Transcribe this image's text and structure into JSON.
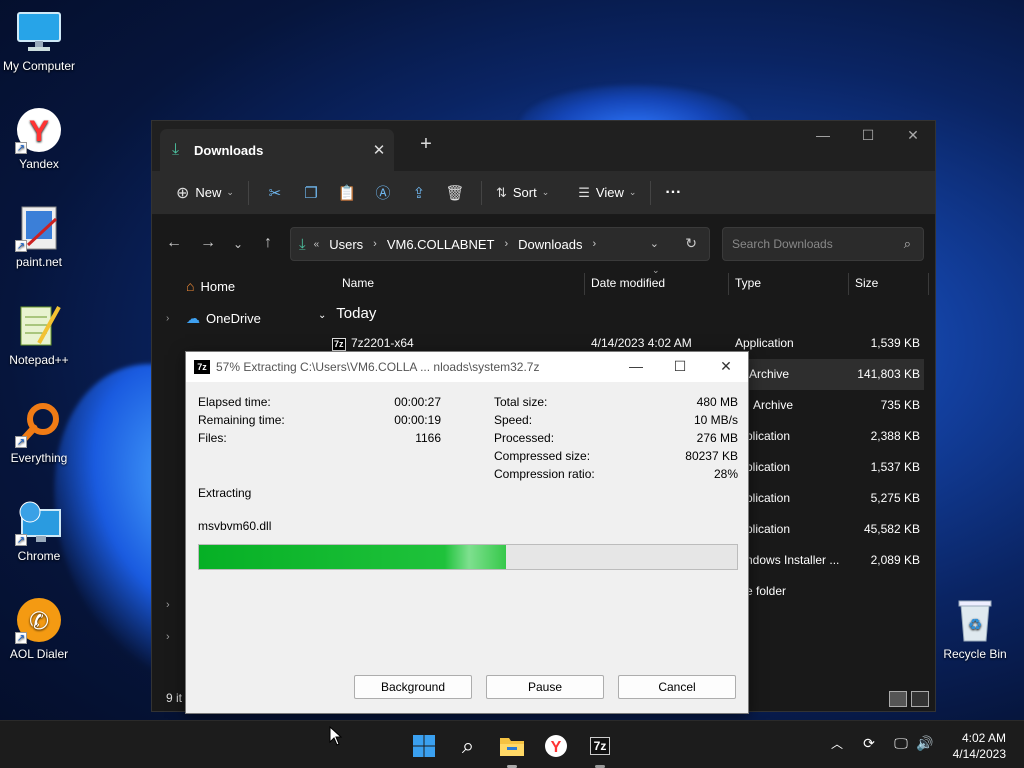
{
  "desktop": {
    "icons": [
      {
        "label": "My Computer",
        "icon": "monitor-icon"
      },
      {
        "label": "Yandex",
        "icon": "yandex-icon"
      },
      {
        "label": "paint.net",
        "icon": "paintnet-icon"
      },
      {
        "label": "Notepad++",
        "icon": "notepadpp-icon"
      },
      {
        "label": "Everything",
        "icon": "everything-icon"
      },
      {
        "label": "Chrome",
        "icon": "chrome-icon"
      },
      {
        "label": "AOL Dialer",
        "icon": "aol-dialer-icon"
      },
      {
        "label": "Recycle Bin",
        "icon": "recycle-bin-icon"
      }
    ]
  },
  "explorer": {
    "tab_title": "Downloads",
    "toolbar": {
      "new_label": "New",
      "sort_label": "Sort",
      "view_label": "View",
      "more_label": "···"
    },
    "breadcrumb": [
      "Users",
      "VM6.COLLABNET",
      "Downloads"
    ],
    "search_placeholder": "Search Downloads",
    "nav": {
      "home": "Home",
      "onedrive": "OneDrive"
    },
    "columns": {
      "name": "Name",
      "date": "Date modified",
      "type": "Type",
      "size": "Size"
    },
    "group": "Today",
    "rows": [
      {
        "name": "7z2201-x64",
        "date": "4/14/2023 4:02 AM",
        "type": "Application",
        "size": "1,539 KB"
      },
      {
        "name": "",
        "date": "",
        "type": "Archive",
        "size": "141,803 KB"
      },
      {
        "name": "",
        "date": "",
        "type": "Archive",
        "size": "735 KB"
      },
      {
        "name": "",
        "date": "",
        "type": "plication",
        "size": "2,388 KB"
      },
      {
        "name": "",
        "date": "",
        "type": "plication",
        "size": "1,537 KB"
      },
      {
        "name": "",
        "date": "",
        "type": "plication",
        "size": "5,275 KB"
      },
      {
        "name": "",
        "date": "",
        "type": "plication",
        "size": "45,582 KB"
      },
      {
        "name": "",
        "date": "",
        "type": "ndows Installer ...",
        "size": "2,089 KB"
      },
      {
        "name": "",
        "date": "",
        "type": "e folder",
        "size": ""
      }
    ],
    "status": "9 it"
  },
  "sevenzip": {
    "title": "57% Extracting C:\\Users\\VM6.COLLA ... nloads\\system32.7z",
    "elapsed_label": "Elapsed time:",
    "elapsed": "00:00:27",
    "remaining_label": "Remaining time:",
    "remaining": "00:00:19",
    "files_label": "Files:",
    "files": "1166",
    "total_label": "Total size:",
    "total": "480 MB",
    "speed_label": "Speed:",
    "speed": "10 MB/s",
    "processed_label": "Processed:",
    "processed": "276 MB",
    "compressed_label": "Compressed size:",
    "compressed": "80237 KB",
    "ratio_label": "Compression ratio:",
    "ratio": "28%",
    "status": "Extracting",
    "current_file": "msvbvm60.dll",
    "progress": 0.57,
    "buttons": {
      "background": "Background",
      "pause": "Pause",
      "cancel": "Cancel"
    }
  },
  "taskbar": {
    "time": "4:02 AM",
    "date": "4/14/2023"
  },
  "colors": {
    "progress": "#06b025",
    "accent": "#4cc2a0"
  }
}
